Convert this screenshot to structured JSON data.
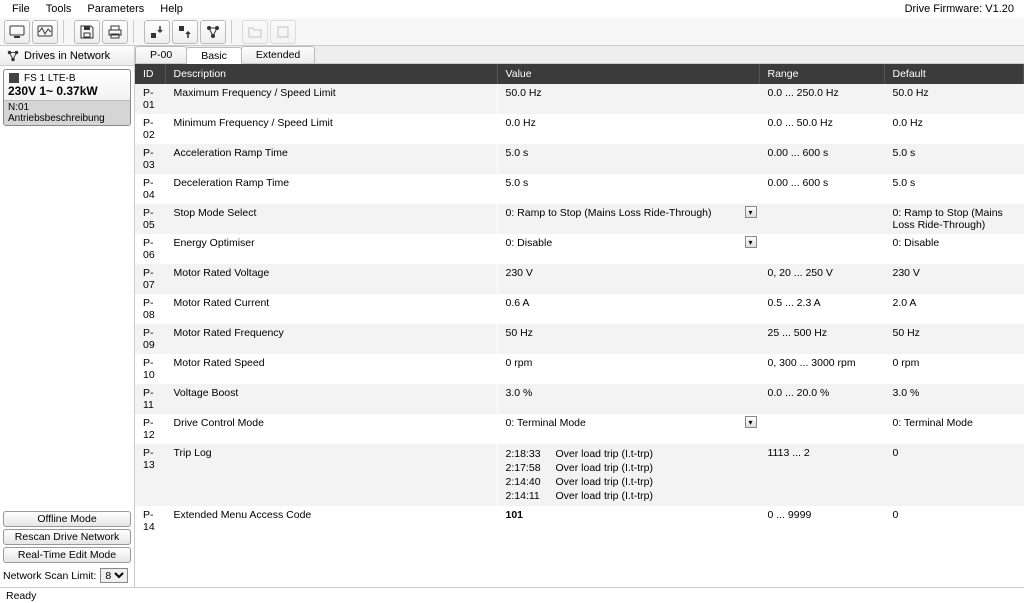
{
  "menu": {
    "file": "File",
    "tools": "Tools",
    "parameters": "Parameters",
    "help": "Help"
  },
  "firmware": "Drive Firmware: V1.20",
  "toolbar": {
    "monitor": {
      "name": "monitor-icon"
    },
    "scope": {
      "name": "scope-icon"
    },
    "save": {
      "name": "save-icon"
    },
    "print": {
      "name": "print-icon"
    },
    "download": {
      "name": "download-to-drive-icon"
    },
    "upload": {
      "name": "upload-from-drive-icon"
    },
    "network": {
      "name": "network-icon"
    },
    "open": {
      "name": "open-icon",
      "disabled": true
    },
    "spare": {
      "name": "spare-icon",
      "disabled": true
    }
  },
  "left": {
    "header": "Drives in Network",
    "drive": {
      "line1": "FS 1   LTE-B",
      "line2": "230V 1~  0.37kW",
      "line3": "N:01  Antriebsbeschreibung"
    },
    "buttons": {
      "offline": "Offline Mode",
      "rescan": "Rescan Drive Network",
      "realtime": "Real-Time Edit Mode"
    },
    "scan_limit_label": "Network Scan Limit:",
    "scan_limit_value": "8"
  },
  "tabs": {
    "p00": "P-00",
    "basic": "Basic",
    "extended": "Extended"
  },
  "cols": {
    "id": "ID",
    "desc": "Description",
    "val": "Value",
    "range": "Range",
    "def": "Default"
  },
  "rows": [
    {
      "id": "P-01",
      "desc": "Maximum Frequency / Speed Limit",
      "val": "50.0 Hz",
      "range": "0.0 ... 250.0 Hz",
      "def": "50.0 Hz"
    },
    {
      "id": "P-02",
      "desc": "Minimum Frequency / Speed Limit",
      "val": "0.0 Hz",
      "range": "0.0 ... 50.0 Hz",
      "def": "0.0 Hz"
    },
    {
      "id": "P-03",
      "desc": "Acceleration Ramp Time",
      "val": "5.0 s",
      "range": "0.00 ... 600 s",
      "def": "5.0 s"
    },
    {
      "id": "P-04",
      "desc": "Deceleration Ramp Time",
      "val": "5.0 s",
      "range": "0.00 ... 600 s",
      "def": "5.0 s"
    },
    {
      "id": "P-05",
      "desc": "Stop Mode Select",
      "val": "0: Ramp to Stop (Mains Loss Ride-Through)",
      "dd": true,
      "range": "",
      "def": "0: Ramp to Stop (Mains Loss Ride-Through)"
    },
    {
      "id": "P-06",
      "desc": "Energy Optimiser",
      "val": "0: Disable",
      "dd": true,
      "range": "",
      "def": "0: Disable"
    },
    {
      "id": "P-07",
      "desc": "Motor Rated Voltage",
      "val": "230 V",
      "range": "0, 20 ... 250 V",
      "def": "230 V"
    },
    {
      "id": "P-08",
      "desc": "Motor Rated Current",
      "val": "0.6 A",
      "range": "0.5 ... 2.3 A",
      "def": "2.0 A"
    },
    {
      "id": "P-09",
      "desc": "Motor Rated Frequency",
      "val": "50 Hz",
      "range": "25 ... 500 Hz",
      "def": "50 Hz"
    },
    {
      "id": "P-10",
      "desc": "Motor Rated Speed",
      "val": "0 rpm",
      "range": "0, 300 ... 3000 rpm",
      "def": "0 rpm"
    },
    {
      "id": "P-11",
      "desc": "Voltage Boost",
      "val": "3.0 %",
      "range": "0.0 ... 20.0 %",
      "def": "3.0 %"
    },
    {
      "id": "P-12",
      "desc": "Drive Control Mode",
      "val": "0: Terminal Mode",
      "dd": true,
      "range": "",
      "def": "0: Terminal Mode"
    },
    {
      "id": "P-13",
      "desc": "Trip Log",
      "val": "",
      "trips": [
        {
          "t": "2:18:33",
          "msg": "Over load trip (I.t-trp)"
        },
        {
          "t": "2:17:58",
          "msg": "Over load trip (I.t-trp)"
        },
        {
          "t": "2:14:40",
          "msg": "Over load trip (I.t-trp)"
        },
        {
          "t": "2:14:11",
          "msg": "Over load trip (I.t-trp)"
        }
      ],
      "range": "1113 ... 2",
      "def": "0"
    },
    {
      "id": "P-14",
      "desc": "Extended Menu Access Code",
      "val": "101",
      "bold": true,
      "range": "0 ... 9999",
      "def": "0"
    }
  ],
  "status": "Ready"
}
